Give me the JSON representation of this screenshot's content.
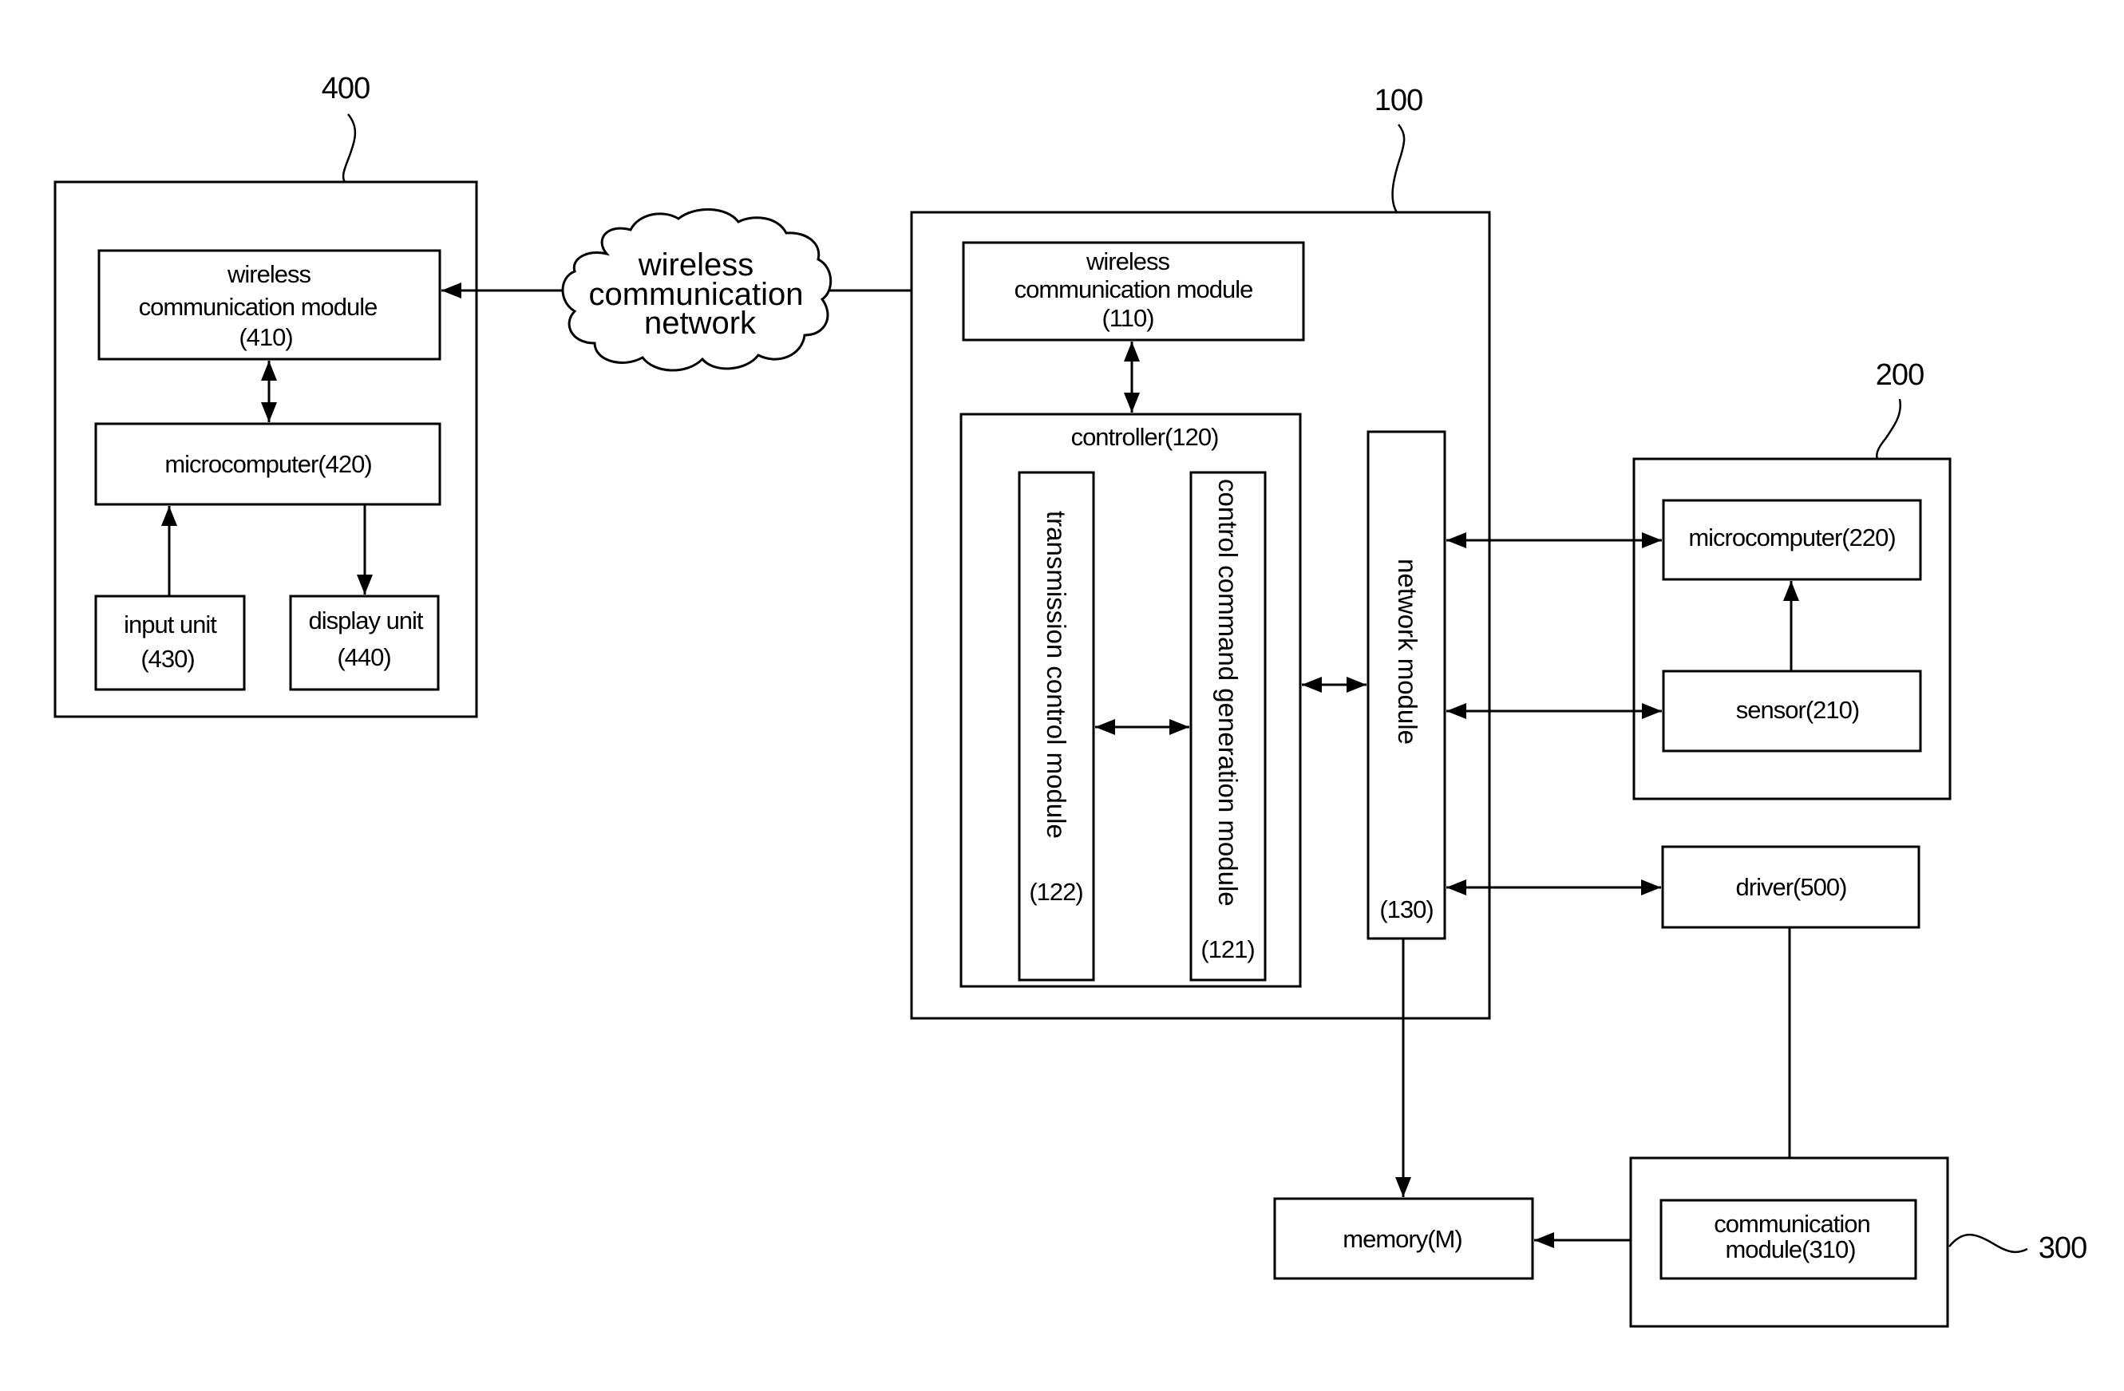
{
  "diagram": {
    "references": {
      "mobile": "400",
      "main": "100",
      "sensing": "200",
      "target": "300"
    },
    "network": {
      "line1": "wireless",
      "line2": "communication",
      "line3": "network"
    },
    "mobile_terminal": {
      "wireless_module": {
        "line1": "wireless",
        "line2": "communication module",
        "line3": "(410)"
      },
      "microcomputer": "microcomputer(420)",
      "input_unit": {
        "line1": "input unit",
        "line2": "(430)"
      },
      "display_unit": {
        "line1": "display unit",
        "line2": "(440)"
      }
    },
    "main_device": {
      "wireless_module": {
        "line1": "wireless",
        "line2": "communication module",
        "line3": "(110)"
      },
      "controller": "controller(120)",
      "transmission_module": {
        "label": "transmission control module",
        "ref": "(122)"
      },
      "command_module": {
        "label": "control command generation module",
        "ref": "(121)"
      },
      "network_module": {
        "label": "network module",
        "ref": "(130)"
      }
    },
    "sensing_device": {
      "microcomputer": "microcomputer(220)",
      "sensor": "sensor(210)"
    },
    "driver": "driver(500)",
    "memory": "memory(M)",
    "target_device": {
      "comm_module": {
        "line1": "communication",
        "line2": "module(310)"
      }
    }
  }
}
